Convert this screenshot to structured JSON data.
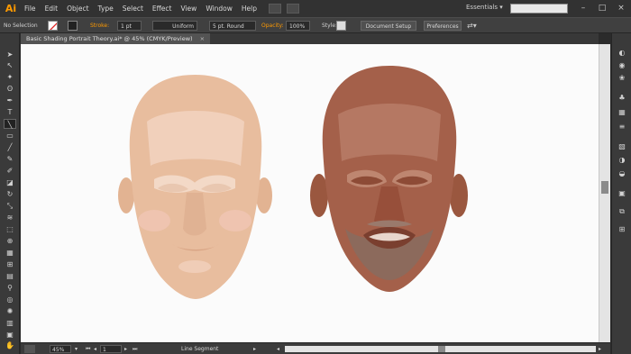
{
  "app": {
    "logo": "Ai"
  },
  "menu": [
    "File",
    "Edit",
    "Object",
    "Type",
    "Select",
    "Effect",
    "View",
    "Window",
    "Help"
  ],
  "workspace": "Essentials",
  "control": {
    "selection_label": "No Selection",
    "stroke_label": "Stroke:",
    "stroke_value": "1 pt",
    "profile_value": "Uniform",
    "brush_value": "5 pt. Round",
    "opacity_label": "Opacity:",
    "opacity_value": "100%",
    "style_label": "Style:",
    "document_setup": "Document Setup",
    "preferences": "Preferences"
  },
  "document": {
    "tab_title": "Basic Shading Portrait Theory.ai* @ 45% (CMYK/Preview)",
    "close": "×"
  },
  "status": {
    "zoom": "45%",
    "artboard": "1",
    "tool_name": "Line Segment"
  },
  "colors": {
    "light_skin": "#e8bd9e",
    "light_highlight": "#f3d6c2",
    "dark_skin": "#a4604a",
    "dark_highlight": "#b57863",
    "beard": "#8c6a5c",
    "accent": "#ff9a00"
  },
  "icons": {
    "toolbar": [
      "selection-arrow",
      "direct-selection",
      "magic-wand",
      "lasso",
      "pen",
      "type",
      "line-segment",
      "rectangle",
      "paintbrush",
      "pencil",
      "blob-brush",
      "eraser",
      "rotate",
      "scale",
      "width",
      "free-transform",
      "shape-builder",
      "perspective-grid",
      "mesh",
      "gradient",
      "eyedropper",
      "blend",
      "symbol-sprayer",
      "column-graph",
      "artboard",
      "slice",
      "hand",
      "zoom"
    ],
    "panels": [
      "color-guide",
      "color",
      "brushes",
      "symbols",
      "swatches",
      "stroke",
      "gradient",
      "transparency",
      "appearance",
      "graphic-styles",
      "layers",
      "artboards"
    ]
  }
}
